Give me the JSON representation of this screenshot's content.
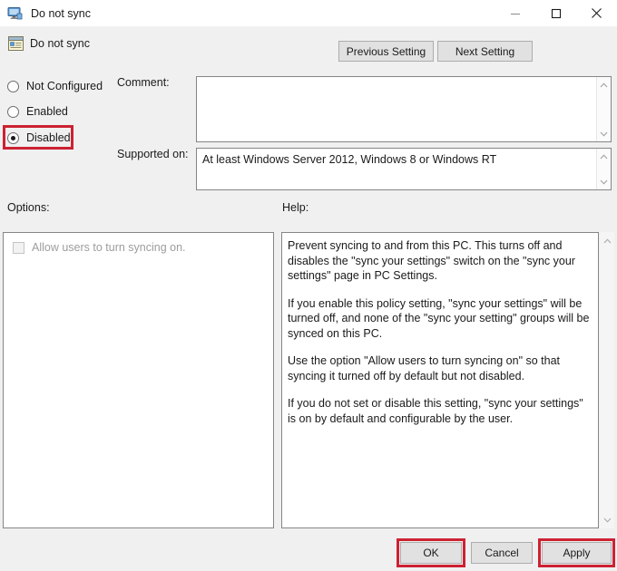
{
  "window": {
    "title": "Do not sync",
    "title_icon": "computer-monitor-icon",
    "minimize_label": "Minimize",
    "maximize_label": "Maximize",
    "close_label": "Close"
  },
  "header": {
    "setting_name": "Do not sync",
    "setting_icon": "policy-setting-icon",
    "previous_label": "Previous Setting",
    "next_label": "Next Setting"
  },
  "state": {
    "options": [
      {
        "label": "Not Configured",
        "selected": false
      },
      {
        "label": "Enabled",
        "selected": false
      },
      {
        "label": "Disabled",
        "selected": true
      }
    ],
    "selected": "Disabled"
  },
  "comment": {
    "label": "Comment:",
    "value": "",
    "placeholder": ""
  },
  "supported_on": {
    "label": "Supported on:",
    "value": "At least Windows Server 2012, Windows 8 or Windows RT"
  },
  "options_panel": {
    "label": "Options:",
    "checkbox_label": "Allow users to turn syncing on.",
    "checkbox_checked": false,
    "checkbox_enabled": false
  },
  "help_panel": {
    "label": "Help:",
    "paragraphs": [
      "Prevent syncing to and from this PC.  This turns off and disables the \"sync your settings\" switch on the \"sync your settings\" page in PC Settings.",
      "If you enable this policy setting, \"sync your settings\" will be turned off, and none of the \"sync your setting\" groups will be synced on this PC.",
      "Use the option \"Allow users to turn syncing on\" so that syncing it turned off by default but not disabled.",
      "If you do not set or disable this setting, \"sync your settings\" is on by default and configurable by the user."
    ]
  },
  "footer": {
    "ok_label": "OK",
    "cancel_label": "Cancel",
    "apply_label": "Apply"
  },
  "annotations": {
    "highlight_color": "#cc2233",
    "highlighted": [
      "Disabled",
      "OK",
      "Apply"
    ]
  }
}
